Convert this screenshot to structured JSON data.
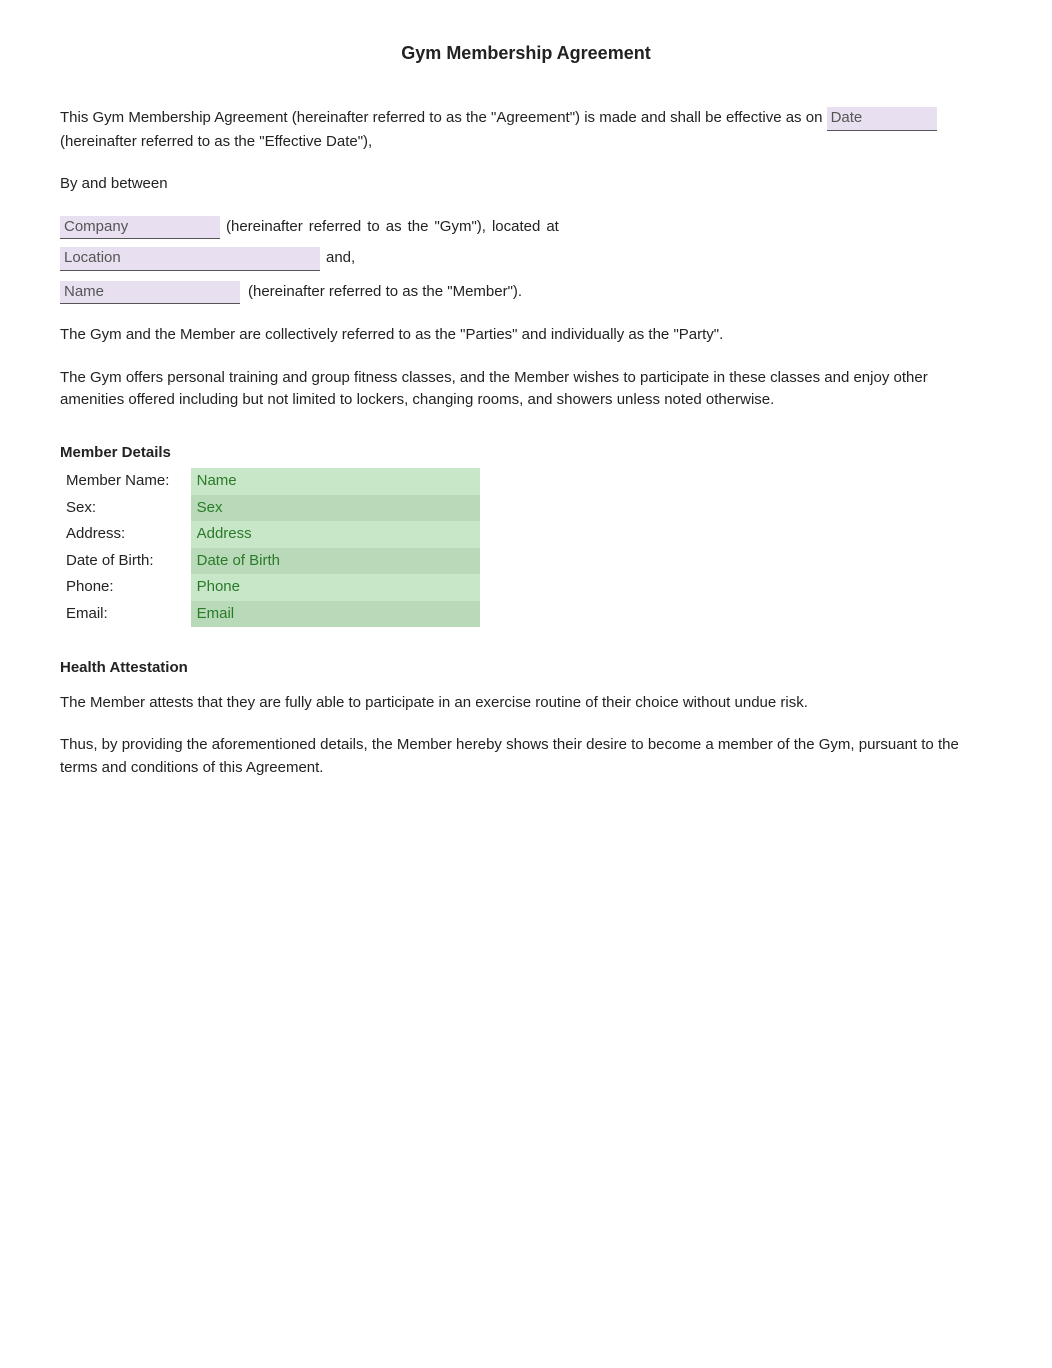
{
  "title": "Gym Membership Agreement",
  "intro": {
    "text1": "This Gym Membership Agreement (hereinafter referred to as the \"Agreement\") is made and shall be effective as on",
    "date_placeholder": "Date",
    "text2": "(hereinafter referred to as the \"Effective Date\"),"
  },
  "by_and_between": "By and between",
  "company": {
    "placeholder": "Company",
    "text1": "(hereinafter",
    "text2": "referred",
    "text3": "to",
    "text4": "as",
    "text5": "the",
    "text6": "\"Gym\"),",
    "text7": "located",
    "text8": "at"
  },
  "location": {
    "placeholder": "Location",
    "text": "and,"
  },
  "name_field": {
    "placeholder": "Name",
    "text": "(hereinafter referred to as the \"Member\")."
  },
  "parties_paragraph": "The Gym and the Member are collectively referred to as the \"Parties\" and individually as the \"Party\".",
  "offers_paragraph": "The Gym offers personal training and group fitness classes, and the Member wishes to participate in these classes and enjoy other amenities offered including but not limited to lockers, changing rooms, and showers unless noted otherwise.",
  "member_details": {
    "title": "Member Details",
    "fields": [
      {
        "label": "Member Name:",
        "placeholder": "Name"
      },
      {
        "label": "Sex:",
        "placeholder": "Sex"
      },
      {
        "label": "Address:",
        "placeholder": "Address"
      },
      {
        "label": "Date of Birth:",
        "placeholder": "Date of Birth"
      },
      {
        "label": "Phone:",
        "placeholder": "Phone"
      },
      {
        "label": "Email:",
        "placeholder": "Email"
      }
    ]
  },
  "health": {
    "title": "Health Attestation",
    "paragraph": "The Member attests that they are fully able to participate in an exercise routine of their choice without undue risk.",
    "desire_paragraph": "Thus, by providing the aforementioned details, the Member hereby shows their desire to become a member of the Gym, pursuant to the terms and conditions of this Agreement."
  }
}
